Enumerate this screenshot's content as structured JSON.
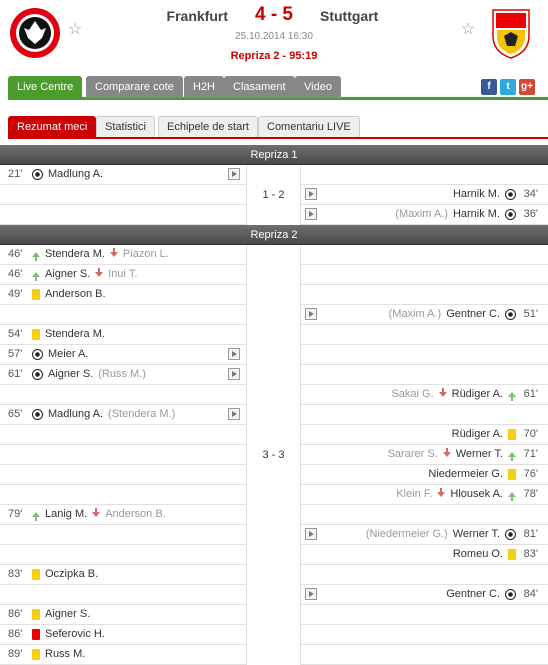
{
  "match": {
    "home": "Frankfurt",
    "away": "Stuttgart",
    "score": "4 - 5",
    "datetime": "25.10.2014 16:30",
    "status": "Repriza 2 - 95:19"
  },
  "main_tabs": [
    "Live Centre",
    "Comparare cote",
    "H2H",
    "Clasament",
    "Video"
  ],
  "sub_tabs": [
    "Rezumat meci",
    "Statistici",
    "Echipele de start",
    "Comentariu LIVE"
  ],
  "share": {
    "facebook": "f",
    "twitter": "t",
    "google": "g+"
  },
  "periods": [
    {
      "label": "Repriza 1",
      "score": "1 - 2",
      "rows": [
        {
          "side": "home",
          "min": "21'",
          "type": "goal",
          "player": "Madlung A.",
          "video": true
        },
        {
          "side": "away",
          "min": "34'",
          "type": "goal",
          "player": "Harnik M.",
          "video": true
        },
        {
          "side": "away",
          "min": "36'",
          "type": "goal",
          "player": "Harnik M.",
          "assist": "(Maxim A.)",
          "video": true
        }
      ]
    },
    {
      "label": "Repriza 2",
      "score": "3 - 3",
      "rows": [
        {
          "side": "home",
          "min": "46'",
          "type": "sub",
          "player": "Stendera M.",
          "out": "Piazon L."
        },
        {
          "side": "home",
          "min": "46'",
          "type": "sub",
          "player": "Aigner S.",
          "out": "Inui T."
        },
        {
          "side": "home",
          "min": "49'",
          "type": "yellow",
          "player": "Anderson B."
        },
        {
          "side": "away",
          "min": "51'",
          "type": "goal",
          "player": "Gentner C.",
          "assist": "(Maxim A.)",
          "video": true
        },
        {
          "side": "home",
          "min": "54'",
          "type": "yellow",
          "player": "Stendera M."
        },
        {
          "side": "home",
          "min": "57'",
          "type": "goal",
          "player": "Meier A.",
          "video": true
        },
        {
          "side": "home",
          "min": "61'",
          "type": "goal",
          "player": "Aigner S.",
          "assist": "(Russ M.)",
          "video": true
        },
        {
          "side": "away",
          "min": "61'",
          "type": "sub",
          "player": "Rüdiger A.",
          "out": "Sakai G."
        },
        {
          "side": "home",
          "min": "65'",
          "type": "goal",
          "player": "Madlung A.",
          "assist": "(Stendera M.)",
          "video": true
        },
        {
          "side": "away",
          "min": "70'",
          "type": "yellow",
          "player": "Rüdiger A."
        },
        {
          "side": "away",
          "min": "71'",
          "type": "sub",
          "player": "Werner T.",
          "out": "Sararer S."
        },
        {
          "side": "away",
          "min": "76'",
          "type": "yellow",
          "player": "Niedermeier G."
        },
        {
          "side": "away",
          "min": "78'",
          "type": "sub",
          "player": "Hlousek A.",
          "out": "Klein F."
        },
        {
          "side": "home",
          "min": "79'",
          "type": "sub",
          "player": "Lanig M.",
          "out": "Anderson B."
        },
        {
          "side": "away",
          "min": "81'",
          "type": "goal",
          "player": "Werner T.",
          "assist": "(Niedermeier G.)",
          "video": true
        },
        {
          "side": "away",
          "min": "83'",
          "type": "yellow",
          "player": "Romeu O."
        },
        {
          "side": "home",
          "min": "83'",
          "type": "yellow",
          "player": "Oczipka B."
        },
        {
          "side": "away",
          "min": "84'",
          "type": "goal",
          "player": "Gentner C.",
          "video": true
        },
        {
          "side": "home",
          "min": "86'",
          "type": "yellow",
          "player": "Aigner S."
        },
        {
          "side": "home",
          "min": "86'",
          "type": "red",
          "player": "Seferovic H."
        },
        {
          "side": "home",
          "min": "89'",
          "type": "yellow",
          "player": "Russ M."
        }
      ]
    }
  ],
  "colors": {
    "accent_green": "#4b9b2e",
    "accent_red": "#cc0000",
    "yellow_card": "#f5d10a",
    "red_card": "#ee0000"
  }
}
